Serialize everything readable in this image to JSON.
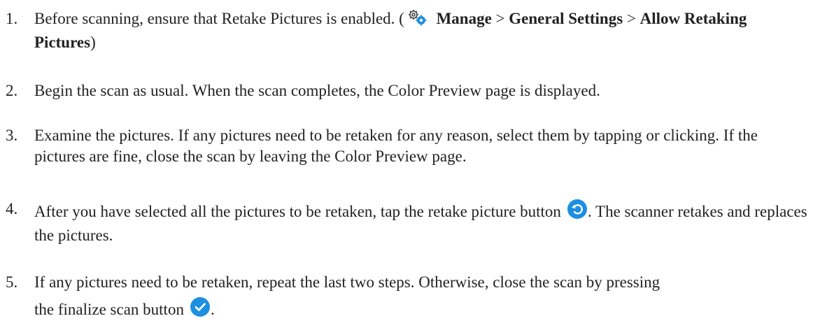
{
  "steps": [
    {
      "number": "1.",
      "text_before": "Before scanning, ensure that Retake Pictures is enabled. (",
      "icon": "gear-icon",
      "path1": "Manage",
      "sep1": " > ",
      "path2": "General Settings",
      "sep2": " > ",
      "path3": "Allow Retaking Pictures",
      "text_after": ")"
    },
    {
      "number": "2.",
      "text": "Begin the scan as usual. When the scan completes, the Color Preview page is displayed."
    },
    {
      "number": "3.",
      "text": "Examine the pictures. If any pictures need to be retaken for any reason, select them by tapping or clicking. If the pictures are fine, close the scan by leaving the Color Preview page."
    },
    {
      "number": "4.",
      "text_before": "After you have selected all the pictures to be retaken, tap the retake picture button",
      "icon": "retake-icon",
      "text_after": ". The scanner retakes and replaces the pictures."
    },
    {
      "number": "5.",
      "text_line1": "If any pictures need to be retaken, repeat the last two steps. Otherwise, close the scan by pressing",
      "text_before": "the finalize scan button",
      "icon": "checkmark-icon",
      "text_after": "."
    }
  ],
  "colors": {
    "text": "#222222",
    "icon_blue": "#1d8fe1"
  }
}
